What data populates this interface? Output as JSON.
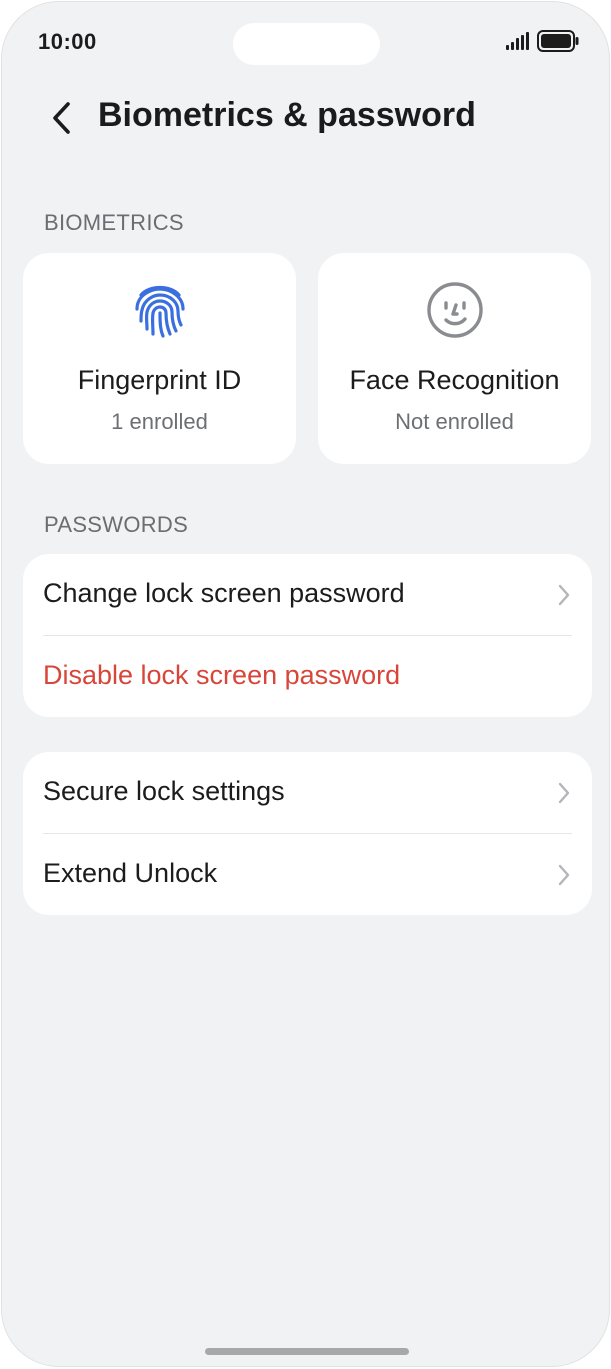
{
  "status_bar": {
    "time": "10:00"
  },
  "header": {
    "back_icon": "chevron-left-icon",
    "title": "Biometrics & password"
  },
  "sections": {
    "biometrics_label": "BIOMETRICS",
    "passwords_label": "PASSWORDS"
  },
  "biometrics": [
    {
      "icon": "fingerprint-icon",
      "title": "Fingerprint ID",
      "status": "1 enrolled",
      "icon_color": "#3a6fe0"
    },
    {
      "icon": "face-icon",
      "title": "Face Recognition",
      "status": "Not enrolled",
      "icon_color": "#8a8c90"
    }
  ],
  "passwords": [
    {
      "label": "Change lock screen password",
      "has_chevron": true,
      "danger": false
    },
    {
      "label": "Disable lock screen password",
      "has_chevron": false,
      "danger": true,
      "color": "#d8463a"
    }
  ],
  "more_settings": [
    {
      "label": "Secure lock settings",
      "has_chevron": true
    },
    {
      "label": "Extend Unlock",
      "has_chevron": true
    }
  ]
}
